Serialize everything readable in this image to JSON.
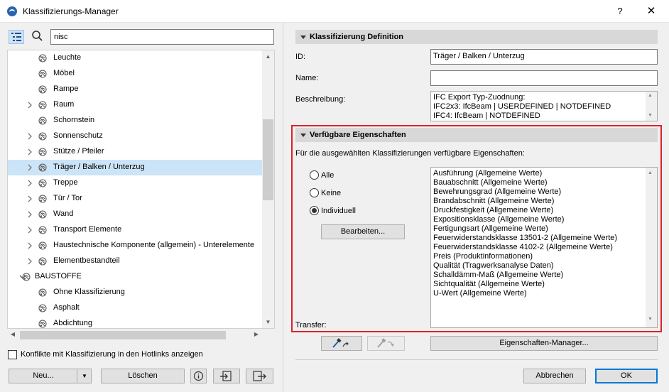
{
  "window": {
    "title": "Klassifizierungs-Manager",
    "help": "?",
    "close": "✕"
  },
  "search": {
    "value": "nisc"
  },
  "tree": {
    "items": [
      {
        "label": "Leuchte",
        "expandable": false,
        "level": 2
      },
      {
        "label": "Möbel",
        "expandable": false,
        "level": 2
      },
      {
        "label": "Rampe",
        "expandable": false,
        "level": 2
      },
      {
        "label": "Raum",
        "expandable": true,
        "level": 2
      },
      {
        "label": "Schornstein",
        "expandable": false,
        "level": 2
      },
      {
        "label": "Sonnenschutz",
        "expandable": true,
        "level": 2
      },
      {
        "label": "Stütze / Pfeiler",
        "expandable": true,
        "level": 2
      },
      {
        "label": "Träger / Balken / Unterzug",
        "expandable": true,
        "level": 2,
        "selected": true
      },
      {
        "label": "Treppe",
        "expandable": true,
        "level": 2
      },
      {
        "label": "Tür / Tor",
        "expandable": true,
        "level": 2
      },
      {
        "label": "Wand",
        "expandable": true,
        "level": 2
      },
      {
        "label": "Transport Elemente",
        "expandable": true,
        "level": 2
      },
      {
        "label": "Haustechnische Komponente (allgemein) - Unterelemente",
        "expandable": true,
        "level": 2
      },
      {
        "label": "Elementbestandteil",
        "expandable": true,
        "level": 2
      },
      {
        "label": "BAUSTOFFE",
        "expandable": true,
        "expanded": true,
        "level": 1
      },
      {
        "label": "Ohne Klassifizierung",
        "expandable": false,
        "level": 2
      },
      {
        "label": "Asphalt",
        "expandable": false,
        "level": 2
      },
      {
        "label": "Abdichtung",
        "expandable": false,
        "level": 2
      }
    ]
  },
  "left_footer": {
    "conflict_label": "Konflikte mit Klassifizierung in den Hotlinks anzeigen",
    "new_label": "Neu...",
    "delete_label": "Löschen"
  },
  "definition": {
    "header": "Klassifizierung Definition",
    "id_label": "ID:",
    "id_value": "Träger / Balken / Unterzug",
    "name_label": "Name:",
    "name_value": "",
    "desc_label": "Beschreibung:",
    "desc_lines": [
      "IFC Export Typ-Zuodnung:",
      "IFC2x3: IfcBeam | USERDEFINED | NOTDEFINED",
      "IFC4: IfcBeam | NOTDEFINED"
    ]
  },
  "properties": {
    "header": "Verfügbare Eigenschaften",
    "intro": "Für die ausgewählten Klassifizierungen verfügbare Eigenschaften:",
    "radio_all": "Alle",
    "radio_none": "Keine",
    "radio_individual": "Individuell",
    "selected_radio": "Individuell",
    "edit_button": "Bearbeiten...",
    "list": [
      "Ausführung (Allgemeine Werte)",
      "Bauabschnitt (Allgemeine Werte)",
      "Bewehrungsgrad (Allgemeine Werte)",
      "Brandabschnitt (Allgemeine Werte)",
      "Druckfestigkeit (Allgemeine Werte)",
      "Expositionsklasse (Allgemeine Werte)",
      "Fertigungsart (Allgemeine Werte)",
      "Feuerwiderstandsklasse 13501-2 (Allgemeine Werte)",
      "Feuerwiderstandsklasse 4102-2 (Allgemeine Werte)",
      "Preis (Produktinformationen)",
      "Qualität (Tragwerksanalyse Daten)",
      "Schalldämm-Maß (Allgemeine Werte)",
      "Sichtqualität (Allgemeine Werte)",
      "U-Wert (Allgemeine Werte)"
    ],
    "transfer_label": "Transfer:",
    "manager_button": "Eigenschaften-Manager..."
  },
  "dialog_buttons": {
    "cancel": "Abbrechen",
    "ok": "OK"
  },
  "colors": {
    "highlight_box": "#e0202a",
    "selection": "#cce4f7",
    "accent": "#0078d7"
  }
}
